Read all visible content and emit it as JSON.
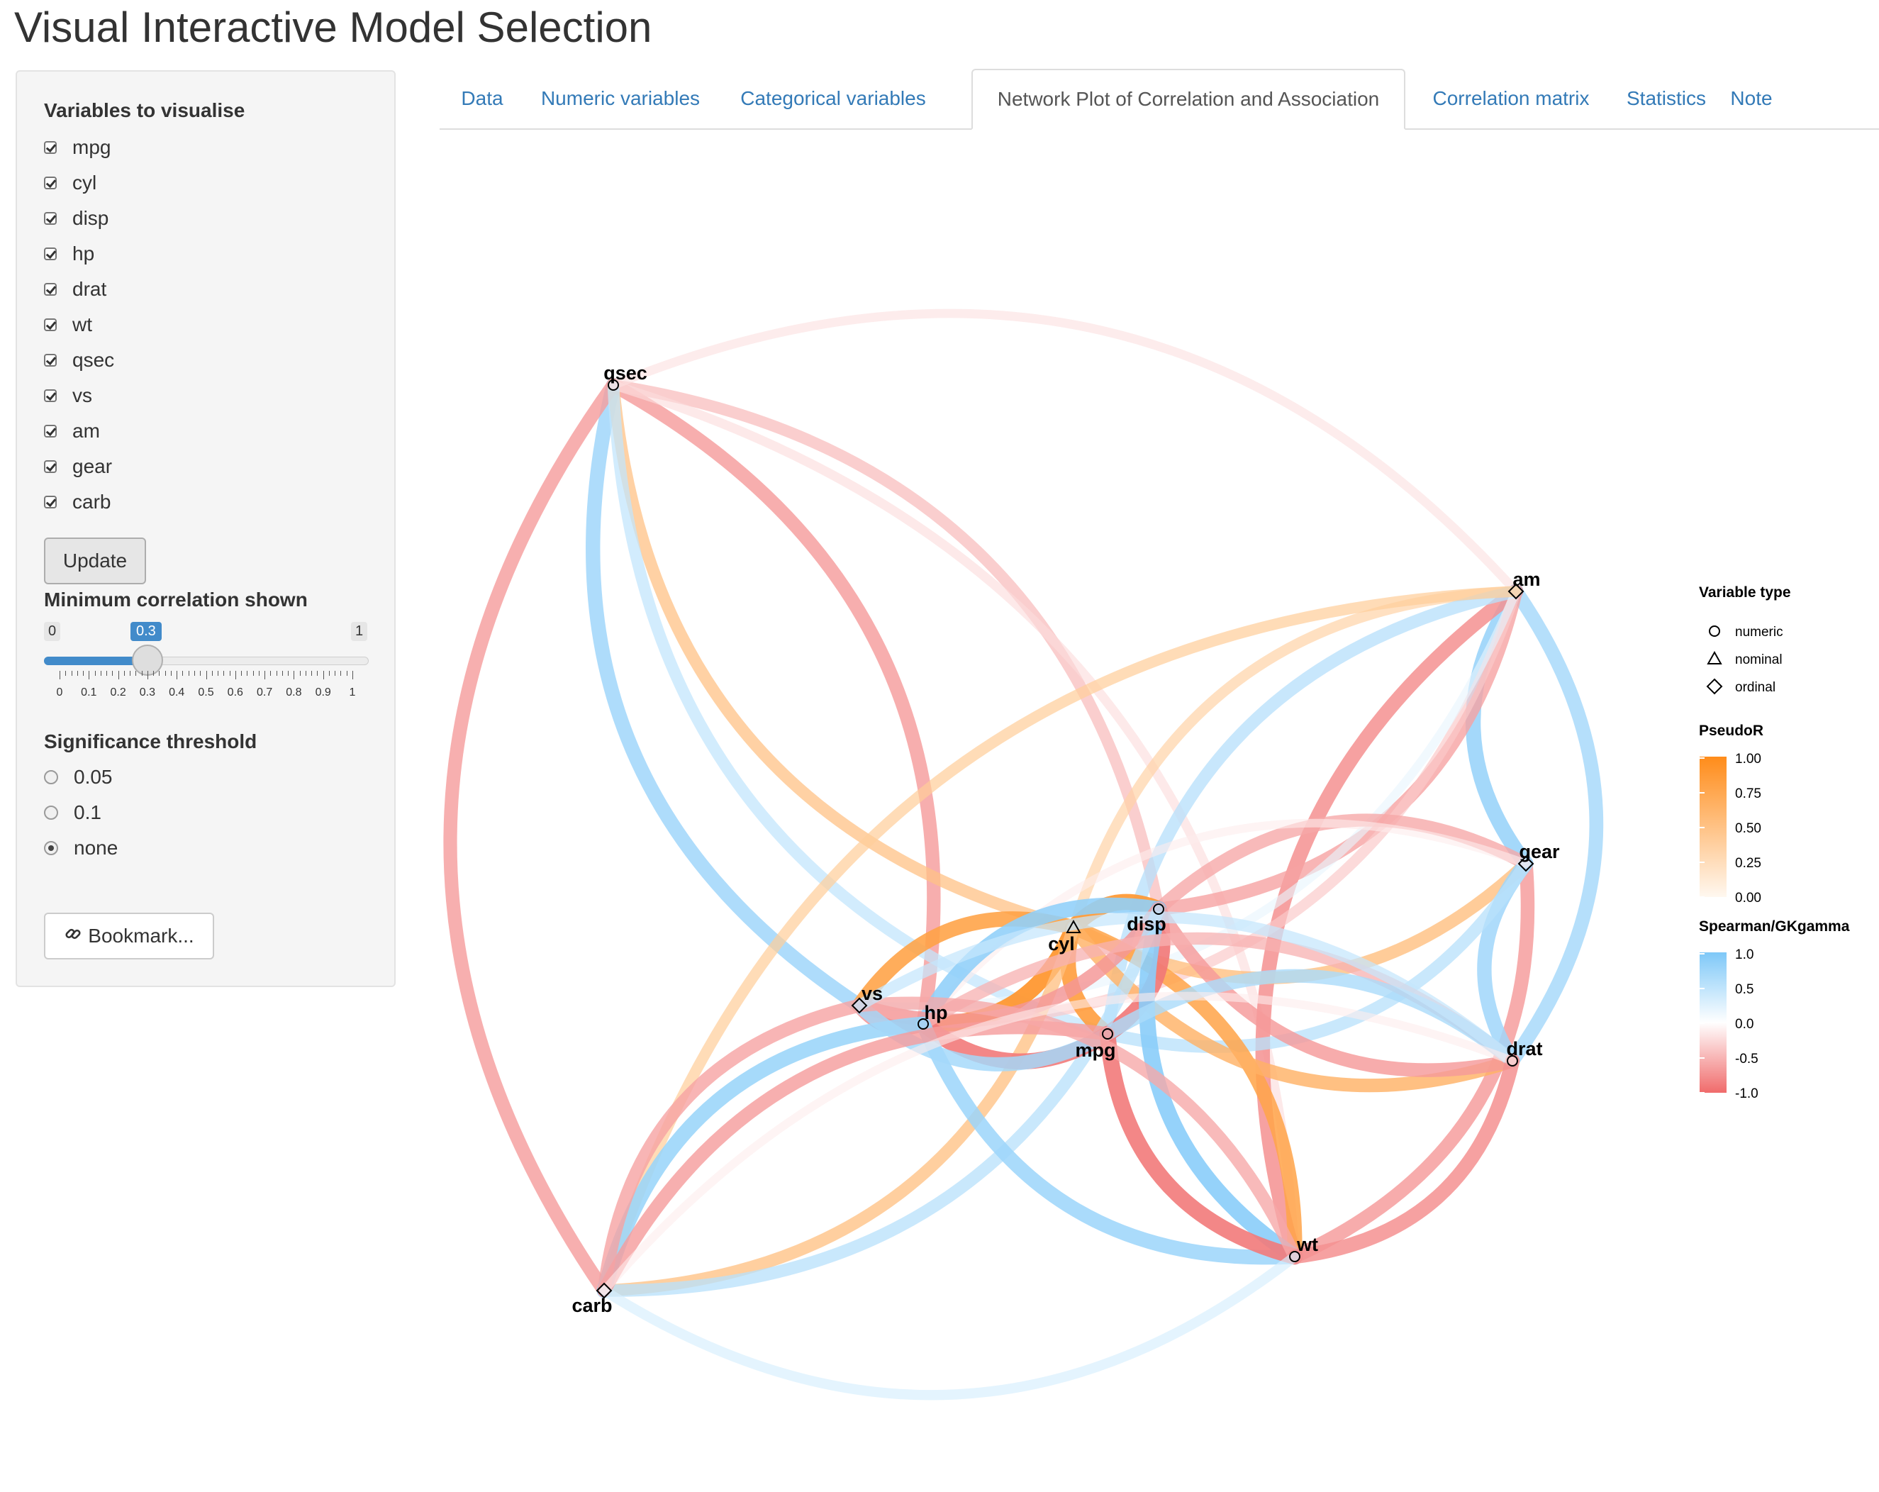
{
  "app": {
    "title": "Visual Interactive Model Selection"
  },
  "sidebar": {
    "variables_label": "Variables to visualise",
    "variables": [
      "mpg",
      "cyl",
      "disp",
      "hp",
      "drat",
      "wt",
      "qsec",
      "vs",
      "am",
      "gear",
      "carb"
    ],
    "update_button": "Update",
    "min_corr_label": "Minimum correlation shown",
    "slider": {
      "min": "0",
      "max": "1",
      "value": "0.3",
      "value_fraction": 0.3,
      "tick_labels": [
        "0",
        "0.1",
        "0.2",
        "0.3",
        "0.4",
        "0.5",
        "0.6",
        "0.7",
        "0.8",
        "0.9",
        "1"
      ]
    },
    "sig_label": "Significance threshold",
    "sig_options": [
      "0.05",
      "0.1",
      "none"
    ],
    "sig_selected": "none",
    "bookmark_button": "Bookmark...",
    "bookmark_icon": "link-icon"
  },
  "tabs": [
    {
      "label": "Data",
      "active": false
    },
    {
      "label": "Numeric variables",
      "active": false
    },
    {
      "label": "Categorical variables",
      "active": false
    },
    {
      "label": "Network Plot of Correlation and Association",
      "active": true
    },
    {
      "label": "Correlation matrix",
      "active": false
    },
    {
      "label": "Statistics",
      "active": false
    },
    {
      "label": "Note",
      "active": false
    }
  ],
  "legend": {
    "type_title": "Variable type",
    "types": [
      {
        "shape": "circle",
        "label": "numeric"
      },
      {
        "shape": "triangle",
        "label": "nominal"
      },
      {
        "shape": "diamond",
        "label": "ordinal"
      }
    ],
    "pseudo_title": "PseudoR",
    "pseudo_ticks": [
      "1.00",
      "0.75",
      "0.50",
      "0.25",
      "0.00"
    ],
    "pseudo_colors": [
      "#ff8c1a",
      "#fff8f0"
    ],
    "spear_title": "Spearman/GKgamma",
    "spear_ticks": [
      "1.0",
      "0.5",
      "0.0",
      "-0.5",
      "-1.0"
    ],
    "spear_colors": [
      "#7ec8f8",
      "#ffffff",
      "#f06b6b"
    ]
  },
  "network": {
    "nodes": [
      {
        "id": "qsec",
        "type": "numeric"
      },
      {
        "id": "am",
        "type": "ordinal"
      },
      {
        "id": "gear",
        "type": "ordinal"
      },
      {
        "id": "cyl",
        "type": "nominal"
      },
      {
        "id": "disp",
        "type": "numeric"
      },
      {
        "id": "vs",
        "type": "ordinal"
      },
      {
        "id": "hp",
        "type": "numeric"
      },
      {
        "id": "mpg",
        "type": "numeric"
      },
      {
        "id": "drat",
        "type": "numeric"
      },
      {
        "id": "wt",
        "type": "numeric"
      },
      {
        "id": "carb",
        "type": "ordinal"
      }
    ],
    "edges": [
      {
        "a": "qsec",
        "b": "vs",
        "kind": "spearman",
        "value": 0.74
      },
      {
        "a": "qsec",
        "b": "hp",
        "kind": "spearman",
        "value": -0.67
      },
      {
        "a": "qsec",
        "b": "carb",
        "kind": "spearman",
        "value": -0.66
      },
      {
        "a": "qsec",
        "b": "disp",
        "kind": "spearman",
        "value": -0.45
      },
      {
        "a": "qsec",
        "b": "cyl",
        "kind": "pseudor",
        "value": 0.5
      },
      {
        "a": "qsec",
        "b": "wt",
        "kind": "spearman",
        "value": -0.23
      },
      {
        "a": "qsec",
        "b": "mpg",
        "kind": "spearman",
        "value": 0.47
      },
      {
        "a": "qsec",
        "b": "am",
        "kind": "spearman",
        "value": -0.2
      },
      {
        "a": "am",
        "b": "gear",
        "kind": "spearman",
        "value": 0.81
      },
      {
        "a": "am",
        "b": "drat",
        "kind": "spearman",
        "value": 0.69
      },
      {
        "a": "am",
        "b": "wt",
        "kind": "spearman",
        "value": -0.74
      },
      {
        "a": "am",
        "b": "disp",
        "kind": "spearman",
        "value": -0.62
      },
      {
        "a": "am",
        "b": "cyl",
        "kind": "pseudor",
        "value": 0.35
      },
      {
        "a": "am",
        "b": "hp",
        "kind": "spearman",
        "value": -0.36
      },
      {
        "a": "am",
        "b": "mpg",
        "kind": "spearman",
        "value": 0.56
      },
      {
        "a": "am",
        "b": "vs",
        "kind": "spearman",
        "value": 0.17
      },
      {
        "a": "am",
        "b": "carb",
        "kind": "pseudor",
        "value": 0.4
      },
      {
        "a": "gear",
        "b": "cyl",
        "kind": "pseudor",
        "value": 0.55
      },
      {
        "a": "gear",
        "b": "disp",
        "kind": "spearman",
        "value": -0.59
      },
      {
        "a": "gear",
        "b": "wt",
        "kind": "spearman",
        "value": -0.68
      },
      {
        "a": "gear",
        "b": "drat",
        "kind": "spearman",
        "value": 0.74
      },
      {
        "a": "gear",
        "b": "mpg",
        "kind": "spearman",
        "value": 0.54
      },
      {
        "a": "gear",
        "b": "hp",
        "kind": "spearman",
        "value": -0.13
      },
      {
        "a": "cyl",
        "b": "hp",
        "kind": "pseudor",
        "value": 0.92
      },
      {
        "a": "cyl",
        "b": "vs",
        "kind": "pseudor",
        "value": 0.81
      },
      {
        "a": "cyl",
        "b": "disp",
        "kind": "pseudor",
        "value": 0.9
      },
      {
        "a": "cyl",
        "b": "mpg",
        "kind": "pseudor",
        "value": 0.85
      },
      {
        "a": "cyl",
        "b": "wt",
        "kind": "pseudor",
        "value": 0.78
      },
      {
        "a": "cyl",
        "b": "drat",
        "kind": "pseudor",
        "value": 0.65
      },
      {
        "a": "cyl",
        "b": "carb",
        "kind": "pseudor",
        "value": 0.52
      },
      {
        "a": "disp",
        "b": "hp",
        "kind": "spearman",
        "value": 0.85
      },
      {
        "a": "disp",
        "b": "mpg",
        "kind": "spearman",
        "value": -0.91
      },
      {
        "a": "disp",
        "b": "wt",
        "kind": "spearman",
        "value": 0.9
      },
      {
        "a": "disp",
        "b": "vs",
        "kind": "spearman",
        "value": -0.71
      },
      {
        "a": "disp",
        "b": "drat",
        "kind": "spearman",
        "value": -0.68
      },
      {
        "a": "disp",
        "b": "carb",
        "kind": "spearman",
        "value": 0.54
      },
      {
        "a": "hp",
        "b": "mpg",
        "kind": "spearman",
        "value": -0.89
      },
      {
        "a": "hp",
        "b": "vs",
        "kind": "spearman",
        "value": -0.75
      },
      {
        "a": "hp",
        "b": "carb",
        "kind": "spearman",
        "value": 0.79
      },
      {
        "a": "hp",
        "b": "drat",
        "kind": "spearman",
        "value": -0.52
      },
      {
        "a": "hp",
        "b": "wt",
        "kind": "spearman",
        "value": 0.77
      },
      {
        "a": "mpg",
        "b": "vs",
        "kind": "spearman",
        "value": 0.71
      },
      {
        "a": "mpg",
        "b": "wt",
        "kind": "spearman",
        "value": -0.89
      },
      {
        "a": "mpg",
        "b": "drat",
        "kind": "spearman",
        "value": 0.65
      },
      {
        "a": "mpg",
        "b": "carb",
        "kind": "spearman",
        "value": -0.66
      },
      {
        "a": "vs",
        "b": "wt",
        "kind": "spearman",
        "value": -0.59
      },
      {
        "a": "vs",
        "b": "carb",
        "kind": "spearman",
        "value": -0.63
      },
      {
        "a": "vs",
        "b": "drat",
        "kind": "spearman",
        "value": 0.45
      },
      {
        "a": "wt",
        "b": "drat",
        "kind": "spearman",
        "value": -0.75
      },
      {
        "a": "wt",
        "b": "carb",
        "kind": "spearman",
        "value": 0.31
      },
      {
        "a": "drat",
        "b": "carb",
        "kind": "spearman",
        "value": -0.13
      }
    ]
  }
}
